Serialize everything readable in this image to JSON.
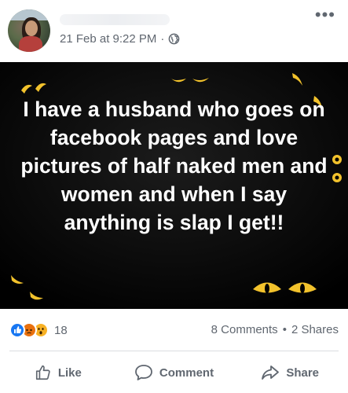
{
  "post": {
    "timestamp": "21 Feb at 9:22 PM",
    "separator": "·",
    "privacy_icon": "globe-icon",
    "more_icon": "more-options-icon",
    "message": "I have a husband who goes on facebook pages and love pictures of half naked men and women and when I say anything is slap I get!!",
    "background_color": "#000000",
    "eye_color": "#f2c22c"
  },
  "stats": {
    "reaction_icons": [
      "like-reaction-icon",
      "angry-reaction-icon",
      "wow-reaction-icon"
    ],
    "reaction_count": "18",
    "comments": "8 Comments",
    "shares": "2 Shares",
    "separator": "•"
  },
  "actions": {
    "like": "Like",
    "comment": "Comment",
    "share": "Share"
  },
  "colors": {
    "meta_text": "#606770",
    "like_blue": "#1877f2",
    "angry_orange": "#e9710f",
    "wow_yellow": "#f7b125"
  }
}
